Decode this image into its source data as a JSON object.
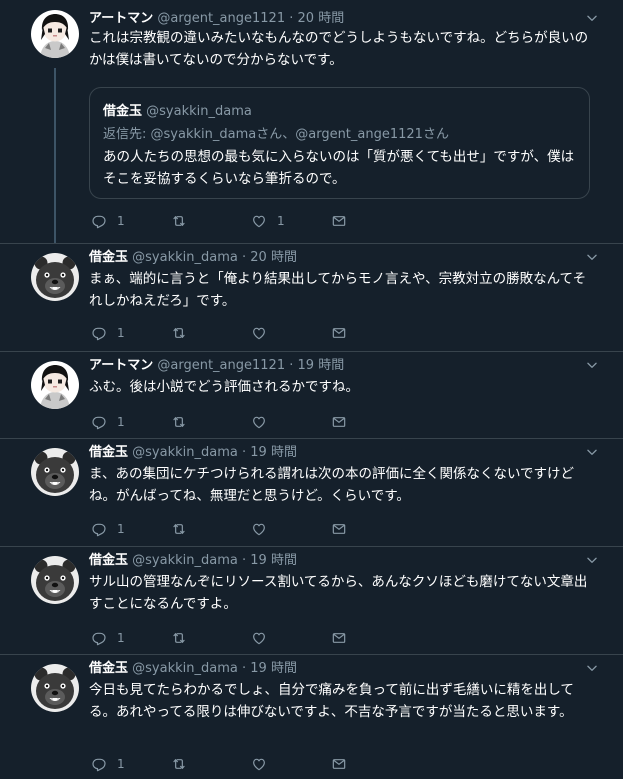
{
  "accent": "#1da1f2",
  "icons": {
    "reply": "reply-icon",
    "retweet": "retweet-icon",
    "like": "like-icon",
    "share": "share-icon",
    "more": "chevron-down-icon"
  },
  "tweets": [
    {
      "name": "アートマン",
      "handle": "@argent_ange1121",
      "dot": "·",
      "time": "20 時間",
      "text": "これは宗教観の違いみたいなもんなのでどうしようもないですね。どちらが良いのかは僕は書いてないので分からないです。",
      "quote": {
        "name": "借金玉",
        "handle": "@syakkin_dama",
        "reply_prefix": "返信先: ",
        "reply_user1": "@syakkin_dama",
        "reply_mid": "さん、",
        "reply_user2": "@argent_ange1121",
        "reply_suffix": "さん",
        "text": "あの人たちの思想の最も気に入らないのは「質が悪くても出せ」ですが、僕はそこを妥協するくらいなら筆折るので。"
      },
      "reply_count": "1",
      "retweet_count": "",
      "like_count": "1"
    },
    {
      "name": "借金玉",
      "handle": "@syakkin_dama",
      "dot": "·",
      "time": "20 時間",
      "text": "まぁ、端的に言うと「俺より結果出してからモノ言えや、宗教対立の勝敗なんてそれしかねえだろ」です。",
      "reply_count": "1",
      "retweet_count": "",
      "like_count": ""
    },
    {
      "name": "アートマン",
      "handle": "@argent_ange1121",
      "dot": "·",
      "time": "19 時間",
      "text": "ふむ。後は小説でどう評価されるかですね。",
      "reply_count": "1",
      "retweet_count": "",
      "like_count": ""
    },
    {
      "name": "借金玉",
      "handle": "@syakkin_dama",
      "dot": "·",
      "time": "19 時間",
      "text": "ま、あの集団にケチつけられる謂れは次の本の評価に全く関係なくないですけどね。がんばってね、無理だと思うけど。くらいです。",
      "reply_count": "1",
      "retweet_count": "",
      "like_count": ""
    },
    {
      "name": "借金玉",
      "handle": "@syakkin_dama",
      "dot": "·",
      "time": "19 時間",
      "text": "サル山の管理なんぞにリソース割いてるから、あんなクソほども磨けてない文章出すことになるんですよ。",
      "reply_count": "1",
      "retweet_count": "",
      "like_count": ""
    },
    {
      "name": "借金玉",
      "handle": "@syakkin_dama",
      "dot": "·",
      "time": "19 時間",
      "text": "今日も見てたらわかるでしょ、自分で痛みを負って前に出ず毛繕いに精を出してる。あれやってる限りは伸びないですよ、不吉な予言ですが当たると思います。",
      "reply_count": "1",
      "retweet_count": "",
      "like_count": ""
    }
  ]
}
